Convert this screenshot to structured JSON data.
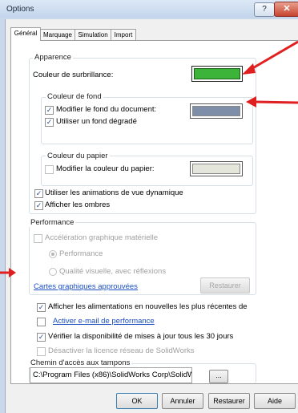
{
  "window": {
    "title": "Options",
    "help": "?",
    "close": "✕"
  },
  "tabs": [
    "Général",
    "Marquage",
    "Simulation",
    "Import"
  ],
  "apparence": {
    "label": "Apparence",
    "surbrillance": "Couleur de surbrillance:",
    "fond_group": "Couleur de fond",
    "modifier_fond": "Modifier le fond du document:",
    "fond_degrade": "Utiliser un fond dégradé",
    "papier_group": "Couleur du papier",
    "modifier_papier": "Modifier la couleur du papier:",
    "animations": "Utiliser les animations de vue dynamique",
    "ombres": "Afficher les ombres"
  },
  "colors": {
    "surbrillance": "#3cb43a",
    "fond": "#7f8ea8",
    "papier": "#e4e6dc",
    "accent_arrow": "#e02020"
  },
  "performance": {
    "label": "Performance",
    "acceleration": "Accélération graphique matérielle",
    "radio_performance": "Performance",
    "radio_qualite": "Qualité visuelle, avec réflexions",
    "link_cartes": "Cartes graphiques approuvées",
    "restaurer": "Restaurer"
  },
  "options": {
    "alimentations": "Afficher les alimentations en nouvelles les plus récentes de",
    "activer_email": "Activer e-mail de performance",
    "verifier": "Vérifier la disponibilité de mises à jour tous les 30 jours",
    "desactiver": "Désactiver la licence réseau de SolidWorks"
  },
  "chemin": {
    "label": "Chemin d'accès aux tampons",
    "value": "C:\\Program Files (x86)\\SolidWorks Corp\\SolidW",
    "browse": "..."
  },
  "buttons": {
    "ok": "OK",
    "annuler": "Annuler",
    "restaurer": "Restaurer",
    "aide": "Aide"
  },
  "check": "✓"
}
